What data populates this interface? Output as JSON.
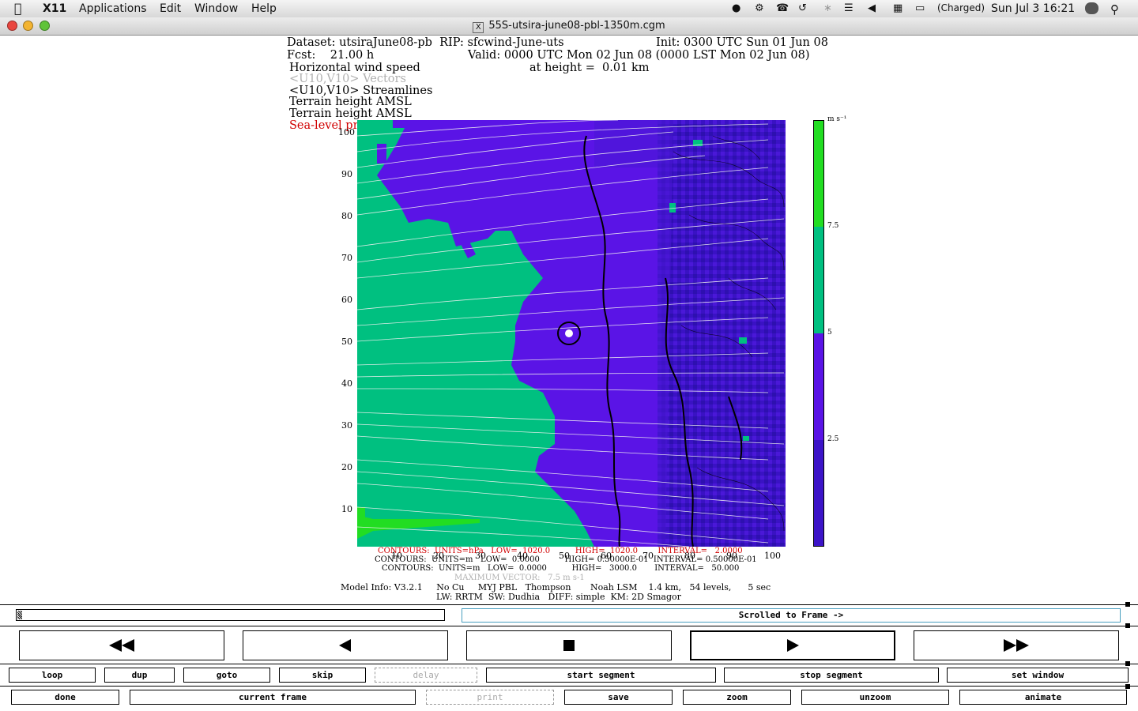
{
  "menubar": {
    "app_name": "X11",
    "items": [
      "Applications",
      "Edit",
      "Window",
      "Help"
    ],
    "battery_status": "(Charged)",
    "clock": "Sun Jul 3  16:21"
  },
  "window": {
    "title": "55S-utsira-june08-pbl-1350m.cgm"
  },
  "plot": {
    "header_left": "Dataset: utsiraJune08-pb  RIP: sfcwind-June-uts",
    "header_init": "Init: 0300 UTC Sun 01 Jun 08",
    "header_fcst": "Fcst:    21.00 h",
    "header_valid": "Valid: 0000 UTC Mon 02 Jun 08 (0000 LST Mon 02 Jun 08)",
    "field1": "Horizontal wind speed",
    "height": "at height =  0.01 km",
    "field2": "<U10,V10> Vectors",
    "field3": "<U10,V10> Streamlines",
    "field4": "Terrain height AMSL",
    "field5": "Terrain height AMSL",
    "field6": "Sea-level pressure",
    "y_ticks": [
      "100",
      "90",
      "80",
      "70",
      "60",
      "50",
      "40",
      "30",
      "20",
      "10"
    ],
    "x_ticks": [
      "10",
      "20",
      "30",
      "40",
      "50",
      "60",
      "70",
      "80",
      "90",
      "100"
    ],
    "colorbar_unit": "m s⁻¹",
    "colorbar_labels": [
      "7.5",
      "5",
      "2.5"
    ],
    "contours1": "CONTOURS:  UNITS=hPa   LOW=  1020.0          HIGH=  1020.0        INTERVAL=   2.0000",
    "contours2": "CONTOURS:  UNITS=m   LOW=  0.0000          HIGH= 0.50000E-01  INTERVAL= 0.50000E-01",
    "contours3": "CONTOURS:  UNITS=m   LOW=  0.0000          HIGH=   3000.0       INTERVAL=   50.000",
    "max_vector": "MAXIMUM VECTOR:   7.5 m s-1",
    "model_info1": "Model Info: V3.2.1     No Cu     MYJ PBL   Thompson       Noah LSM    1.4 km,   54 levels,      5 sec",
    "model_info2": "LW: RRTM  SW: Dudhia   DIFF: simple  KM: 2D Smagor",
    "colors": {
      "land": "#00c080",
      "water": "#5a14e6",
      "water_dark": "#3c14c8",
      "bright": "#22dd22"
    }
  },
  "controls": {
    "status_text": "Scrolled to Frame ->",
    "transport": [
      "rewind",
      "step-back",
      "stop",
      "play",
      "fast-forward"
    ],
    "row1": [
      "loop",
      "dup",
      "goto",
      "skip",
      "delay",
      "start segment",
      "stop segment",
      "set window"
    ],
    "row2": [
      "done",
      "current frame",
      "print",
      "save",
      "zoom",
      "unzoom",
      "animate"
    ]
  }
}
